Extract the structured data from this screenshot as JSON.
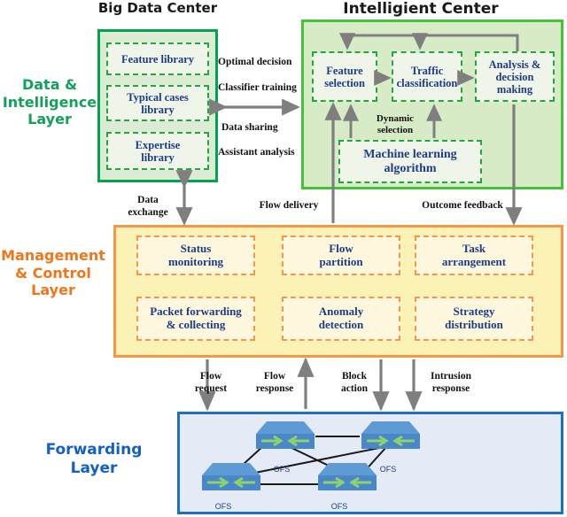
{
  "titles": {
    "big_data_center": "Big Data Center",
    "intelligent_center": "Intelligient Center"
  },
  "layers": [
    {
      "id": "data-intelligence",
      "label": "Data &\nIntelligence\nLayer",
      "color": "#13a05a"
    },
    {
      "id": "management-control",
      "label": "Management\n& Control\nLayer",
      "color": "#f0761a"
    },
    {
      "id": "forwarding",
      "label": "Forwarding\nLayer",
      "color": "#1260c4"
    }
  ],
  "big_data_center": {
    "border_color": "#00a44f",
    "fill_color": "#dcecd4",
    "nodes": [
      {
        "id": "feature-library",
        "label": "Feature library"
      },
      {
        "id": "typical-cases-library",
        "label": "Typical cases\nlibrary"
      },
      {
        "id": "expertise-library",
        "label": "Expertise\nlibrary"
      }
    ]
  },
  "intelligent_center": {
    "border_color": "#45c13a",
    "fill_color": "#d6ebc6",
    "nodes": [
      {
        "id": "feature-selection",
        "label": "Feature\nselection"
      },
      {
        "id": "traffic-classification",
        "label": "Traffic\nclassification"
      },
      {
        "id": "analysis-decision-making",
        "label": "Analysis &\ndecision\nmaking"
      },
      {
        "id": "machine-learning-algorithm",
        "label": "Machine learning\nalgorithm"
      }
    ]
  },
  "management_layer": {
    "border_color": "#f79646",
    "fill_color": "#fbf2b6",
    "nodes": [
      {
        "id": "status-monitoring",
        "label": "Status\nmonitoring"
      },
      {
        "id": "flow-partition",
        "label": "Flow\npartition"
      },
      {
        "id": "task-arrangement",
        "label": "Task\narrangement"
      },
      {
        "id": "packet-forwarding-collecting",
        "label": "Packet forwarding\n& collecting"
      },
      {
        "id": "anomaly-detection",
        "label": "Anomaly\ndetection"
      },
      {
        "id": "strategy-distribution",
        "label": "Strategy\ndistribution"
      }
    ]
  },
  "forwarding_layer": {
    "border_color": "#1f6fc4",
    "fill_color": "#e4ebf7",
    "switch_label": "OFS",
    "switches": [
      {
        "id": "ofs-top-left",
        "label": "OFS"
      },
      {
        "id": "ofs-top-right",
        "label": "OFS"
      },
      {
        "id": "ofs-bottom-left",
        "label": "OFS"
      },
      {
        "id": "ofs-bottom-right",
        "label": "OFS"
      }
    ]
  },
  "connector_labels": {
    "optimal_decision": "Optimal decision",
    "classifier_training": "Classifier training",
    "data_sharing": "Data sharing",
    "assistant_analysis": "Assistant analysis",
    "data_exchange": "Data\nexchange",
    "flow_delivery": "Flow delivery",
    "outcome_feedback": "Outcome feedback",
    "dynamic_selection": "Dynamic\nselection",
    "flow_request": "Flow\nrequest",
    "flow_response": "Flow\nresponse",
    "block_action": "Block\naction",
    "intrusion_response": "Intrusion\nresponse"
  },
  "colors": {
    "arrow_gray": "#7f7f7f",
    "node_text": "#1f3b87",
    "switch_body": "#4a87c8",
    "switch_top": "#5e9bd4",
    "switch_arrow": "#8fd16a",
    "link_line": "#1a1a1a"
  }
}
